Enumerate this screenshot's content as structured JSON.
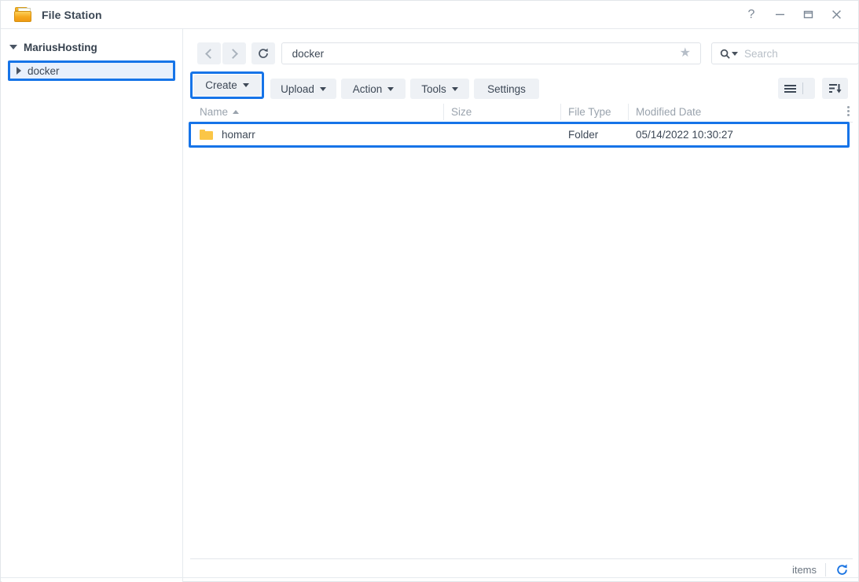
{
  "window": {
    "title": "File Station",
    "icon": "folder-icon",
    "controls": {
      "help": "?",
      "minimize": "minimize-icon",
      "maximize": "maximize-icon",
      "close": "close-icon"
    }
  },
  "sidebar": {
    "root": {
      "label": "MariusHosting",
      "expanded": true
    },
    "items": [
      {
        "label": "docker",
        "expanded": false,
        "selected": true
      }
    ]
  },
  "navbar": {
    "back": "back-icon",
    "forward": "forward-icon",
    "refresh": "refresh-icon",
    "path_value": "docker",
    "path_placeholder": "",
    "favorite": "star-icon",
    "search_placeholder": "Search"
  },
  "toolbar": {
    "buttons": [
      {
        "label": "Create",
        "dropdown": true,
        "highlighted": true
      },
      {
        "label": "Upload",
        "dropdown": true,
        "highlighted": false
      },
      {
        "label": "Action",
        "dropdown": true,
        "highlighted": false
      },
      {
        "label": "Tools",
        "dropdown": true,
        "highlighted": false
      },
      {
        "label": "Settings",
        "dropdown": false,
        "highlighted": false
      }
    ],
    "view_button": "list-view-icon",
    "view_dropdown": "chevron-down-icon",
    "sort_button": "sort-descending-icon"
  },
  "file_list": {
    "columns": [
      {
        "label": "Name",
        "sorted": "asc"
      },
      {
        "label": "Size"
      },
      {
        "label": "File Type"
      },
      {
        "label": "Modified Date"
      }
    ],
    "column_options": "kebab-icon",
    "rows": [
      {
        "name": "homarr",
        "size": "",
        "file_type": "Folder",
        "modified_date": "05/14/2022 10:30:27",
        "icon": "folder-icon",
        "selected": true
      }
    ]
  },
  "statusbar": {
    "items_label": "items",
    "refresh": "refresh-icon"
  },
  "colors": {
    "highlight": "#1674e8",
    "accent_blue": "#1a74e2",
    "folder_yellow": "#fbc647",
    "button_bg": "#eef1f5"
  }
}
